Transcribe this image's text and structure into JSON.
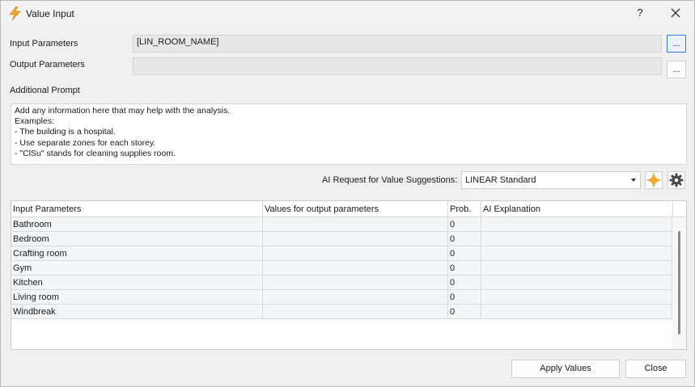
{
  "window": {
    "title": "Value Input",
    "help_label": "?",
    "icon": "lightning-icon",
    "close_icon": "close-icon"
  },
  "form": {
    "input_parameters_label": "Input Parameters",
    "input_parameters_value": "[LIN_ROOM_NAME]",
    "output_parameters_label": "Output Parameters",
    "output_parameters_value": "",
    "browse_label": "...",
    "additional_prompt_label": "Additional Prompt",
    "additional_prompt_text": "Add any information here that may help with the analysis.\nExamples:\n- The building is a hospital.\n- Use separate zones for each storey.\n- \"ClSu\" stands for cleaning supplies room."
  },
  "ai": {
    "request_label": "AI Request for Value Suggestions:",
    "selected_option": "LINEAR Standard",
    "sparkle_icon": "sparkle-icon",
    "settings_icon": "gear-icon",
    "accent_color": "#f5a623"
  },
  "grid": {
    "columns": [
      "Input Parameters",
      "Values for output parameters",
      "Prob.",
      "AI Explanation"
    ],
    "rows": [
      {
        "input": "Bathroom",
        "value": "",
        "prob": "0",
        "explanation": ""
      },
      {
        "input": "Bedroom",
        "value": "",
        "prob": "0",
        "explanation": ""
      },
      {
        "input": "Crafting room",
        "value": "",
        "prob": "0",
        "explanation": ""
      },
      {
        "input": "Gym",
        "value": "",
        "prob": "0",
        "explanation": ""
      },
      {
        "input": "Kitchen",
        "value": "",
        "prob": "0",
        "explanation": ""
      },
      {
        "input": "Living room",
        "value": "",
        "prob": "0",
        "explanation": ""
      },
      {
        "input": "Windbreak",
        "value": "",
        "prob": "0",
        "explanation": ""
      }
    ]
  },
  "buttons": {
    "apply": "Apply Values",
    "close": "Close"
  }
}
